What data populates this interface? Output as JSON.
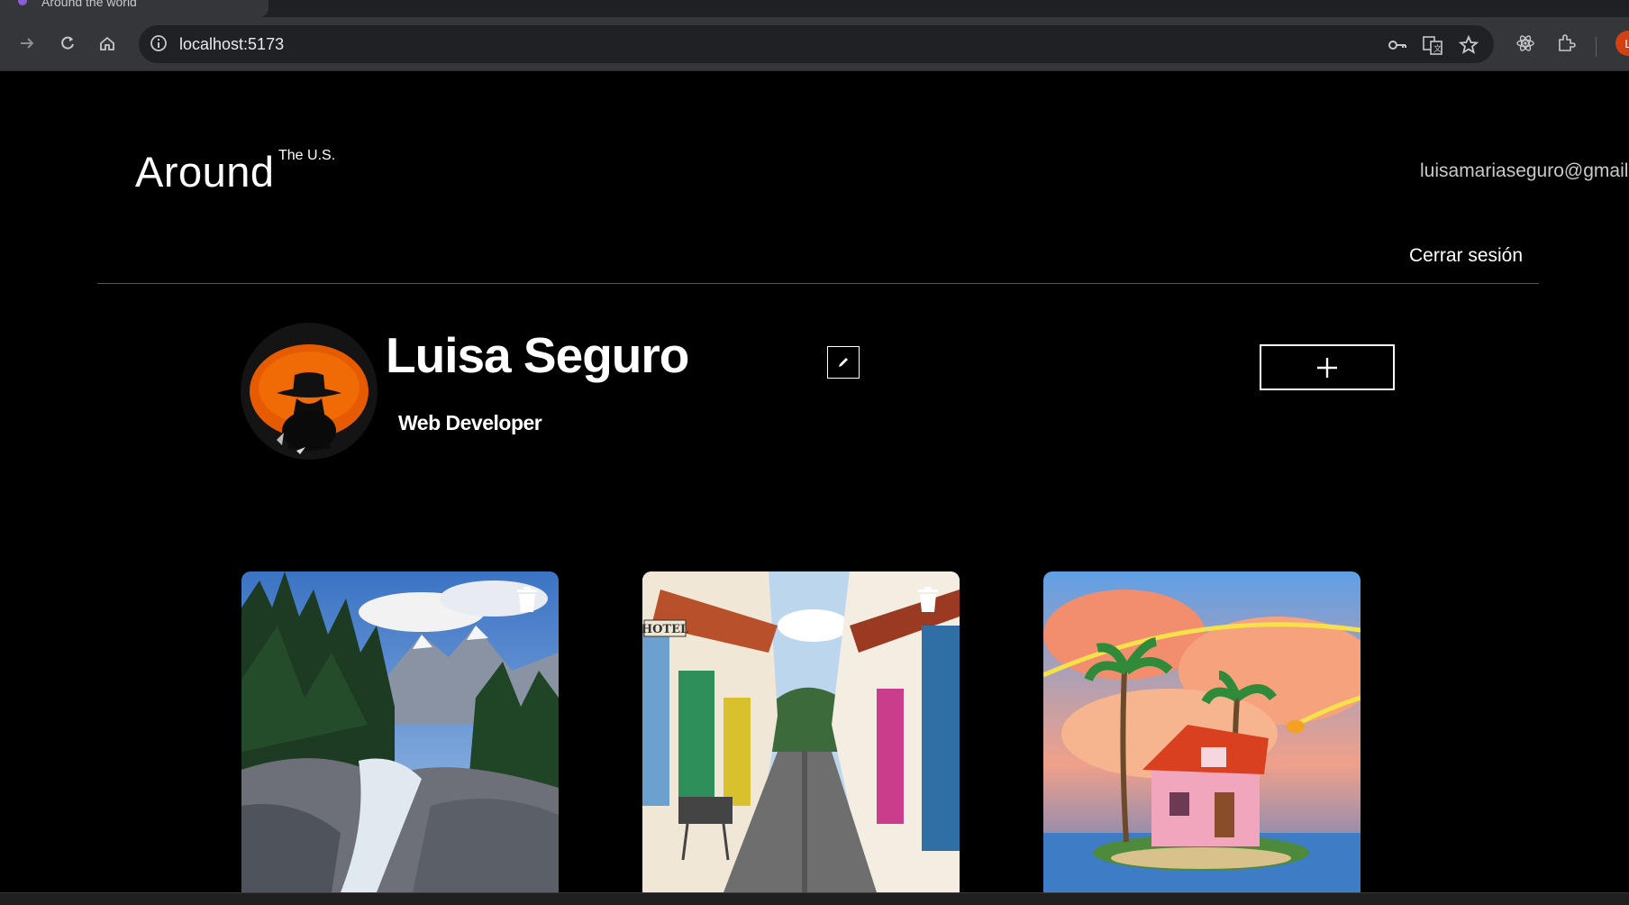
{
  "browser": {
    "tab_title": "Around the world",
    "url": "localhost:5173",
    "profile_initial": "L"
  },
  "header": {
    "logo": "Around",
    "logo_superscript": "The U.S.",
    "email": "luisamariaseguro@gmail.com",
    "logout": "Cerrar sesión"
  },
  "profile": {
    "name": "Luisa Seguro",
    "about": "Web Developer"
  },
  "cards": [
    {
      "image": "mountain-river-canyon",
      "has_delete": true
    },
    {
      "image": "colorful-village-street",
      "has_delete": true
    },
    {
      "image": "island-pink-house",
      "has_delete": false
    }
  ],
  "icons": {
    "back": "arrow-right-icon",
    "reload": "reload-icon",
    "home": "home-icon",
    "edit": "pencil-icon",
    "add": "plus-icon",
    "delete": "trash-icon"
  }
}
